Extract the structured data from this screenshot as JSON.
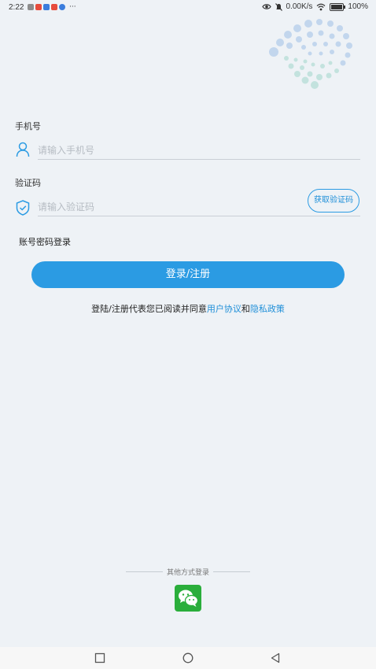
{
  "status_bar": {
    "time": "2:22",
    "more": "···",
    "network_speed": "0.00K/s",
    "battery": "100%",
    "app_colors": [
      "#8d8d8d",
      "#e74c3c",
      "#3b7ddd",
      "#e74c3c",
      "#3b7ddd"
    ]
  },
  "login": {
    "phone_label": "手机号",
    "phone_placeholder": "请输入手机号",
    "code_label": "验证码",
    "code_placeholder": "请输入验证码",
    "get_code_button": "获取验证码",
    "password_login_link": "账号密码登录",
    "submit_button": "登录/注册"
  },
  "agreement": {
    "prefix": "登陆/注册代表您已阅读并同意",
    "user_agreement": "用户协议",
    "connector": "和",
    "privacy_policy": "隐私政策"
  },
  "other_login": {
    "title": "其他方式登录",
    "wechat_icon": "wechat-icon"
  },
  "colors": {
    "accent": "#2b9be3",
    "link": "#1f8fd8",
    "background": "#eef2f6",
    "wechat_green": "#2aae3b"
  },
  "nav_bar": {
    "icons": [
      "recent-apps-icon",
      "home-icon",
      "back-icon"
    ]
  }
}
